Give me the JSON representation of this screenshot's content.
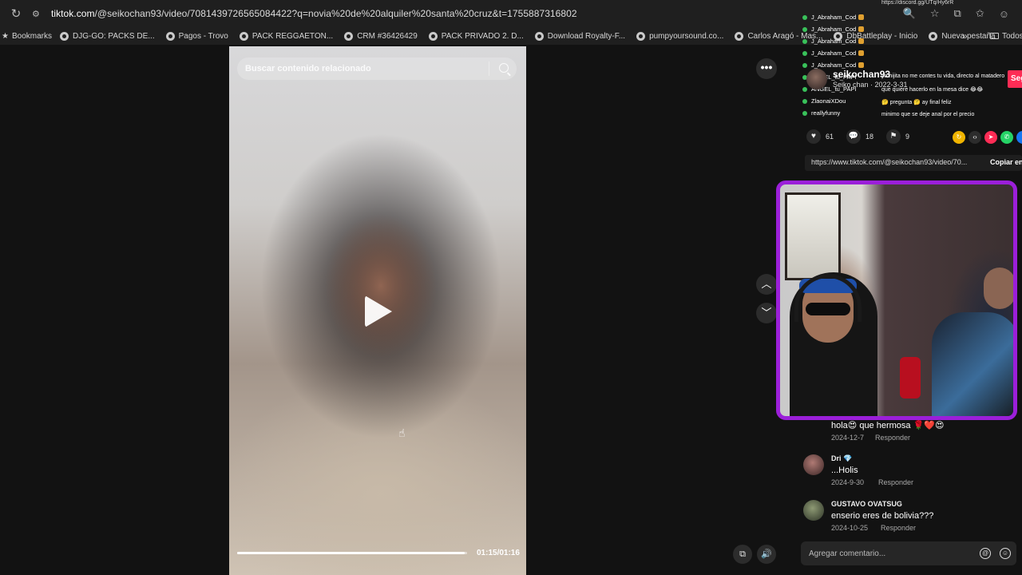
{
  "browser": {
    "url_host": "tiktok.com",
    "url_path": "/@seikochan93/video/7081439726565084422?q=novia%20de%20alquiler%20santa%20cruz&t=1755887316802",
    "bookmarks_label": "Bookmarks",
    "bookmarks": [
      "DJG-GO: PACKS DE...",
      "Pagos - Trovo",
      "PACK REGGAETON...",
      "CRM #36426429",
      "PACK PRIVADO 2. D...",
      "Download Royalty-F...",
      "pumpyoursound.co...",
      "Carlos Aragó - Mas...",
      "DbBattleplay - Inicio",
      "Nueva pestaña"
    ],
    "bookmarks_more": "»",
    "all_bookmarks": "Todos"
  },
  "video": {
    "search_placeholder": "Buscar contenido relacionado",
    "progress": 0.99,
    "time": "01:15/01:16"
  },
  "overlay": {
    "chat_users": [
      "J_Abraham_Cod",
      "J_Abraham_Cod",
      "J_Abraham_Cod",
      "J_Abraham_Cod",
      "J_Abraham_Cod",
      "ANGEL_tu_PAPI",
      "ANGEL_tu_PAPI",
      "ZlaonaiXDou",
      "reallyfunny"
    ],
    "chat_messages": [
      "ya hijita no me contes tu vida, directo al matadero",
      "que quiere hacerlo en la mesa dice 😂😂",
      "🤔 pregunta 🤔 ay final feliz",
      "minimo que se deje anal por el precio"
    ],
    "discord": "https://discord.gg/UTq/Hy6rR"
  },
  "post": {
    "author": "seikochan93",
    "subtitle": "Seiko chan · 2022-3-31",
    "follow": "Seg",
    "likes": "61",
    "comments": "18",
    "saves": "9",
    "link": "https://www.tiktok.com/@seikochan93/video/70...",
    "copy": "Copiar en"
  },
  "comments": [
    {
      "name": "",
      "text": "hola😍 que hermosa 🌹❤️😍",
      "date": "2024-12-7",
      "reply": "Responder"
    },
    {
      "name": "Dri 💎",
      "text": "...Holis",
      "date": "2024-9-30",
      "reply": "Responder"
    },
    {
      "name": "GUSTAVO OVATSUG",
      "text": "enserio eres de bolivia???",
      "date": "2024-10-25",
      "reply": "Responder"
    }
  ],
  "comment_input": {
    "placeholder": "Agregar comentario..."
  },
  "colors": {
    "webcam_border": "#9b1fd9",
    "follow_red": "#fe2c55"
  }
}
